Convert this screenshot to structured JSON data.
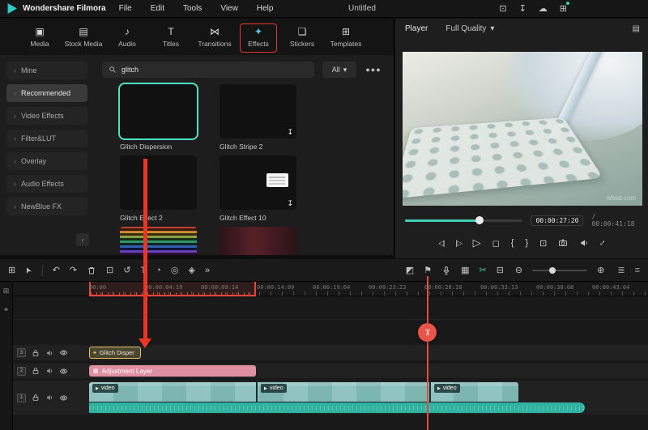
{
  "titlebar": {
    "app_name": "Wondershare Filmora",
    "menus": [
      "File",
      "Edit",
      "Tools",
      "View",
      "Help"
    ],
    "project_title": "Untitled"
  },
  "tabs": {
    "items": [
      {
        "label": "Media"
      },
      {
        "label": "Stock Media"
      },
      {
        "label": "Audio"
      },
      {
        "label": "Titles"
      },
      {
        "label": "Transitions"
      },
      {
        "label": "Effects",
        "active": true
      },
      {
        "label": "Stickers"
      },
      {
        "label": "Templates"
      }
    ]
  },
  "sidebar": {
    "items": [
      {
        "label": "Mine"
      },
      {
        "label": "Recommended",
        "selected": true
      },
      {
        "label": "Video Effects"
      },
      {
        "label": "Filter&LUT"
      },
      {
        "label": "Overlay"
      },
      {
        "label": "Audio Effects"
      },
      {
        "label": "NewBlue FX"
      }
    ]
  },
  "effects_panel": {
    "search_value": "glitch",
    "filter_label": "All",
    "cards": [
      {
        "name": "Glitch Dispersion",
        "selected": true
      },
      {
        "name": "Glitch Stripe 2"
      },
      {
        "name": "Glitch Effect 2"
      },
      {
        "name": "Glitch Effect 10"
      }
    ]
  },
  "player": {
    "label": "Player",
    "quality": "Full Quality",
    "current_time": "00:00:27:20",
    "duration_display": "/  00:00:41:18",
    "watermark": "wbsd.com"
  },
  "timeline": {
    "ruler_labels": [
      "00:00",
      "00:00:04:19",
      "00:00:09:14",
      "00:00:14:09",
      "00:00:19:04",
      "00:00:23:23",
      "00:00:28:18",
      "00:00:33:13",
      "00:00:38:08",
      "00:00:43:04"
    ],
    "track_numbers": [
      "3",
      "2",
      "1"
    ],
    "effect_clip": "Glitch Disper",
    "adjustment_clip": "Adjustment Layer",
    "video_label": "video"
  },
  "colors": {
    "accent_teal": "#3fd0b8",
    "accent_red": "#e8382a",
    "clip_pink": "#df8fa2",
    "clip_video_teal": "#7fb8b5",
    "audio_teal": "#2fb3a0",
    "selection_yellow": "#e6c15c",
    "effect_selected_border": "#4fe0c4"
  }
}
